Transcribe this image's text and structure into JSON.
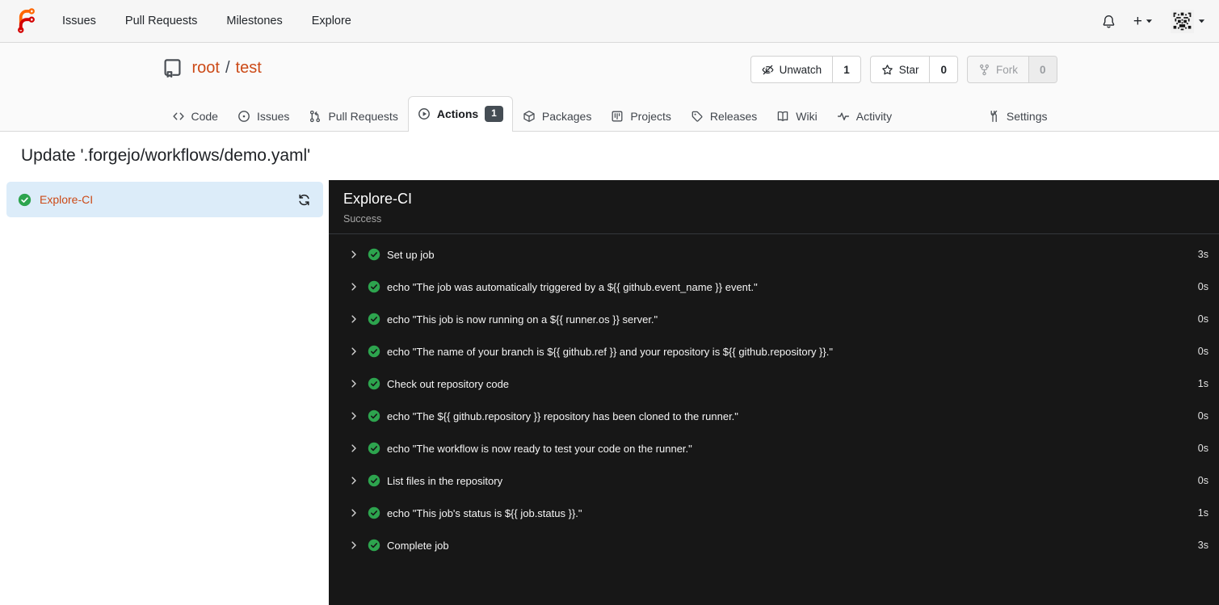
{
  "navbar": {
    "items": [
      {
        "label": "Issues"
      },
      {
        "label": "Pull Requests"
      },
      {
        "label": "Milestones"
      },
      {
        "label": "Explore"
      }
    ],
    "plus_label": "+"
  },
  "repo": {
    "owner": "root",
    "separator": "/",
    "name": "test",
    "actions": {
      "unwatch": {
        "label": "Unwatch",
        "count": "1"
      },
      "star": {
        "label": "Star",
        "count": "0"
      },
      "fork": {
        "label": "Fork",
        "count": "0"
      }
    }
  },
  "tabs": [
    {
      "label": "Code"
    },
    {
      "label": "Issues"
    },
    {
      "label": "Pull Requests"
    },
    {
      "label": "Actions",
      "badge": "1",
      "active": true
    },
    {
      "label": "Packages"
    },
    {
      "label": "Projects"
    },
    {
      "label": "Releases"
    },
    {
      "label": "Wiki"
    },
    {
      "label": "Activity"
    },
    {
      "label": "Settings"
    }
  ],
  "run": {
    "title": "Update '.forgejo/workflows/demo.yaml'",
    "job": {
      "name": "Explore-CI",
      "status_icon": "success"
    },
    "panel": {
      "title": "Explore-CI",
      "status": "Success",
      "steps": [
        {
          "label": "Set up job",
          "duration": "3s"
        },
        {
          "label": "echo \"The job was automatically triggered by a ${{ github.event_name }} event.\"",
          "duration": "0s"
        },
        {
          "label": "echo \"This job is now running on a ${{ runner.os }} server.\"",
          "duration": "0s"
        },
        {
          "label": "echo \"The name of your branch is ${{ github.ref }} and your repository is ${{ github.repository }}.\"",
          "duration": "0s"
        },
        {
          "label": "Check out repository code",
          "duration": "1s"
        },
        {
          "label": "echo \"The ${{ github.repository }} repository has been cloned to the runner.\"",
          "duration": "0s"
        },
        {
          "label": "echo \"The workflow is now ready to test your code on the runner.\"",
          "duration": "0s"
        },
        {
          "label": "List files in the repository",
          "duration": "0s"
        },
        {
          "label": "echo \"This job's status is ${{ job.status }}.\"",
          "duration": "1s"
        },
        {
          "label": "Complete job",
          "duration": "3s"
        }
      ]
    }
  },
  "colors": {
    "brand_orange": "#ff6600",
    "brand_red": "#d40000",
    "link_accent": "#cc4a17",
    "success_green": "#2da44e",
    "sidebar_active_bg": "#dcecf9",
    "log_panel_bg": "#171717",
    "tab_badge_bg": "#454d54"
  }
}
